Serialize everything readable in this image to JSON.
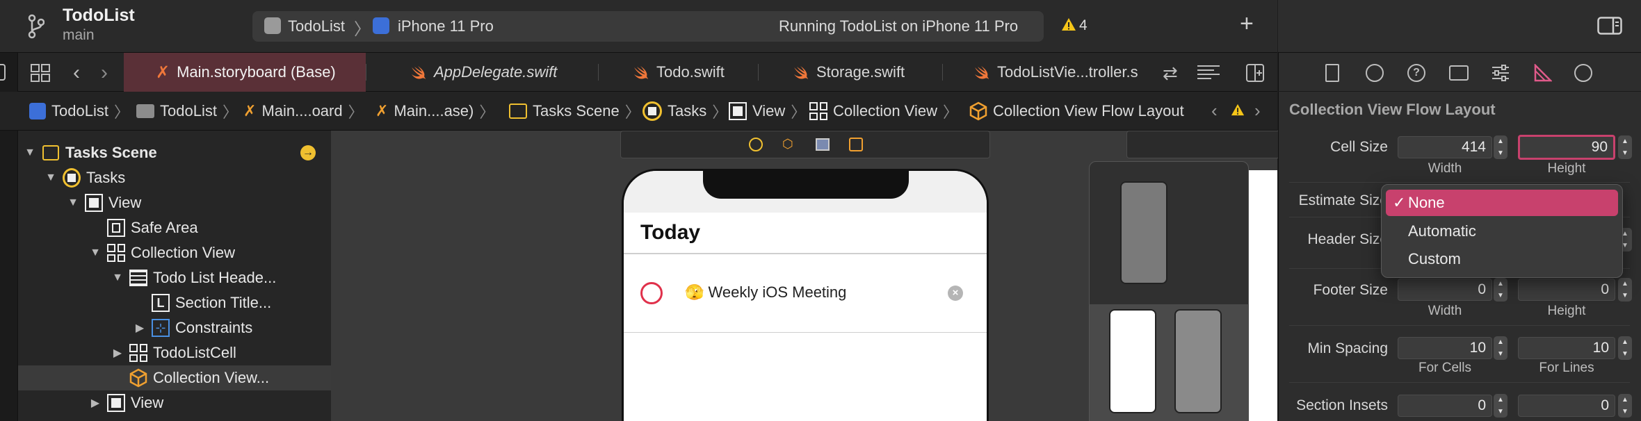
{
  "window": {
    "app_name": "TodoList",
    "branch": "main",
    "scheme_target": "TodoList",
    "device": "iPhone 11 Pro",
    "status": "Running TodoList on iPhone 11 Pro",
    "warning_count": "4"
  },
  "tabs": [
    {
      "label": "Main.storyboard (Base)",
      "active": true
    },
    {
      "label": "AppDelegate.swift",
      "italic": true
    },
    {
      "label": "Todo.swift"
    },
    {
      "label": "Storage.swift"
    },
    {
      "label": "TodoListVie...troller.s"
    }
  ],
  "breadcrumbs": [
    "TodoList",
    "TodoList",
    "Main....oard",
    "Main....ase)",
    "Tasks Scene",
    "Tasks",
    "View",
    "Collection View",
    "Collection View Flow Layout"
  ],
  "outline": {
    "items": [
      {
        "label": "Tasks Scene",
        "icon": "scene-icon"
      },
      {
        "label": "Tasks",
        "icon": "view-controller-icon"
      },
      {
        "label": "View",
        "icon": "view-icon"
      },
      {
        "label": "Safe Area",
        "icon": "safe-area-icon"
      },
      {
        "label": "Collection View",
        "icon": "collection-view-icon"
      },
      {
        "label": "Todo List Heade...",
        "icon": "header-view-icon"
      },
      {
        "label": "Section Title...",
        "icon": "label-icon",
        "glyph": "L"
      },
      {
        "label": "Constraints",
        "icon": "constraints-icon"
      },
      {
        "label": "TodoListCell",
        "icon": "collection-cell-icon"
      },
      {
        "label": "Collection View...",
        "icon": "flow-layout-icon"
      },
      {
        "label": "View",
        "icon": "view-icon"
      }
    ]
  },
  "canvas": {
    "screen_title": "Today",
    "task_text": "🫣 Weekly iOS Meeting"
  },
  "inspector": {
    "title": "Collection View Flow Layout",
    "cell_size_label": "Cell Size",
    "cell_width": "414",
    "cell_height": "90",
    "width_label": "Width",
    "height_label": "Height",
    "estimate_size_label": "Estimate Size",
    "header_size_label": "Header Size",
    "footer_size_label": "Footer Size",
    "footer_width": "0",
    "footer_height": "0",
    "min_spacing_label": "Min Spacing",
    "min_spacing_cells": "10",
    "min_spacing_lines": "10",
    "for_cells_label": "For Cells",
    "for_lines_label": "For Lines",
    "section_insets_label": "Section Insets",
    "inset_a": "0",
    "inset_b": "0"
  },
  "estimate_menu": {
    "options": [
      "None",
      "Automatic",
      "Custom"
    ],
    "selected": "None",
    "checkmark": "✓"
  },
  "colors": {
    "accent": "#e05a8a",
    "active_tab": "#5a3037",
    "selection": "#c8416d",
    "warning": "#f5c518",
    "swift": "#f0773a"
  }
}
